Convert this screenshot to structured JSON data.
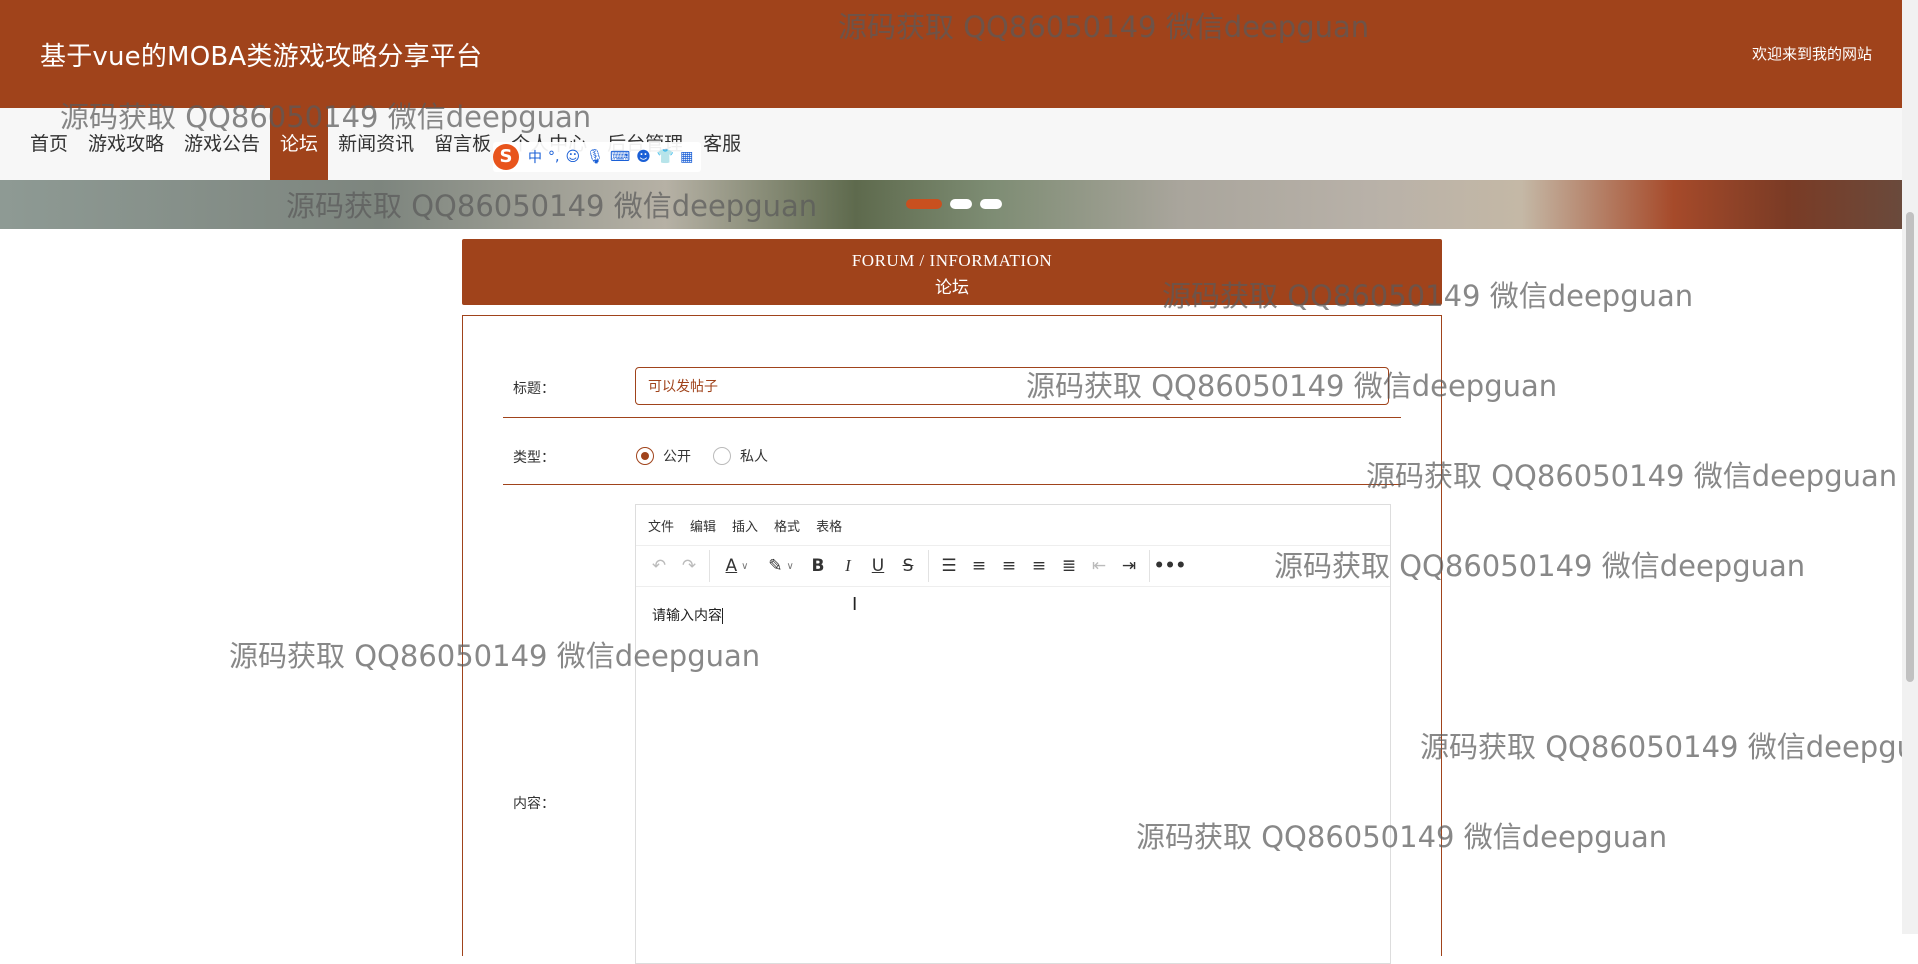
{
  "header": {
    "title": "基于vue的MOBA类游戏攻略分享平台",
    "welcome": "欢迎来到我的网站"
  },
  "nav": {
    "items": [
      "首页",
      "游戏攻略",
      "游戏公告",
      "论坛",
      "新闻资讯",
      "留言板",
      "个人中心",
      "后台管理",
      "客服"
    ],
    "active_index": 3
  },
  "ime_toolbar": {
    "logo": "S",
    "mode": "中",
    "punct": "°,",
    "icons": [
      "emoji-icon",
      "microphone-icon",
      "keyboard-icon",
      "user-icon",
      "shirt-icon",
      "grid-icon"
    ]
  },
  "banner": {
    "slide_count": 3,
    "active_slide": 0
  },
  "forum_header": {
    "english": "FORUM / INFORMATION",
    "chinese": "论坛"
  },
  "form": {
    "title_label": "标题：",
    "title_value": "可以发帖子",
    "type_label": "类型：",
    "type_options": [
      "公开",
      "私人"
    ],
    "type_selected": 0,
    "content_label": "内容：",
    "editor": {
      "menu": [
        "文件",
        "编辑",
        "插入",
        "格式",
        "表格"
      ],
      "content_text": "请输入内容"
    }
  },
  "watermark": {
    "text": "源码获取 QQ86050149 微信deepguan"
  },
  "colors": {
    "brand": "#a0431b",
    "nav_background": "#f7f7f7",
    "ime_blue": "#1a5fd6"
  }
}
